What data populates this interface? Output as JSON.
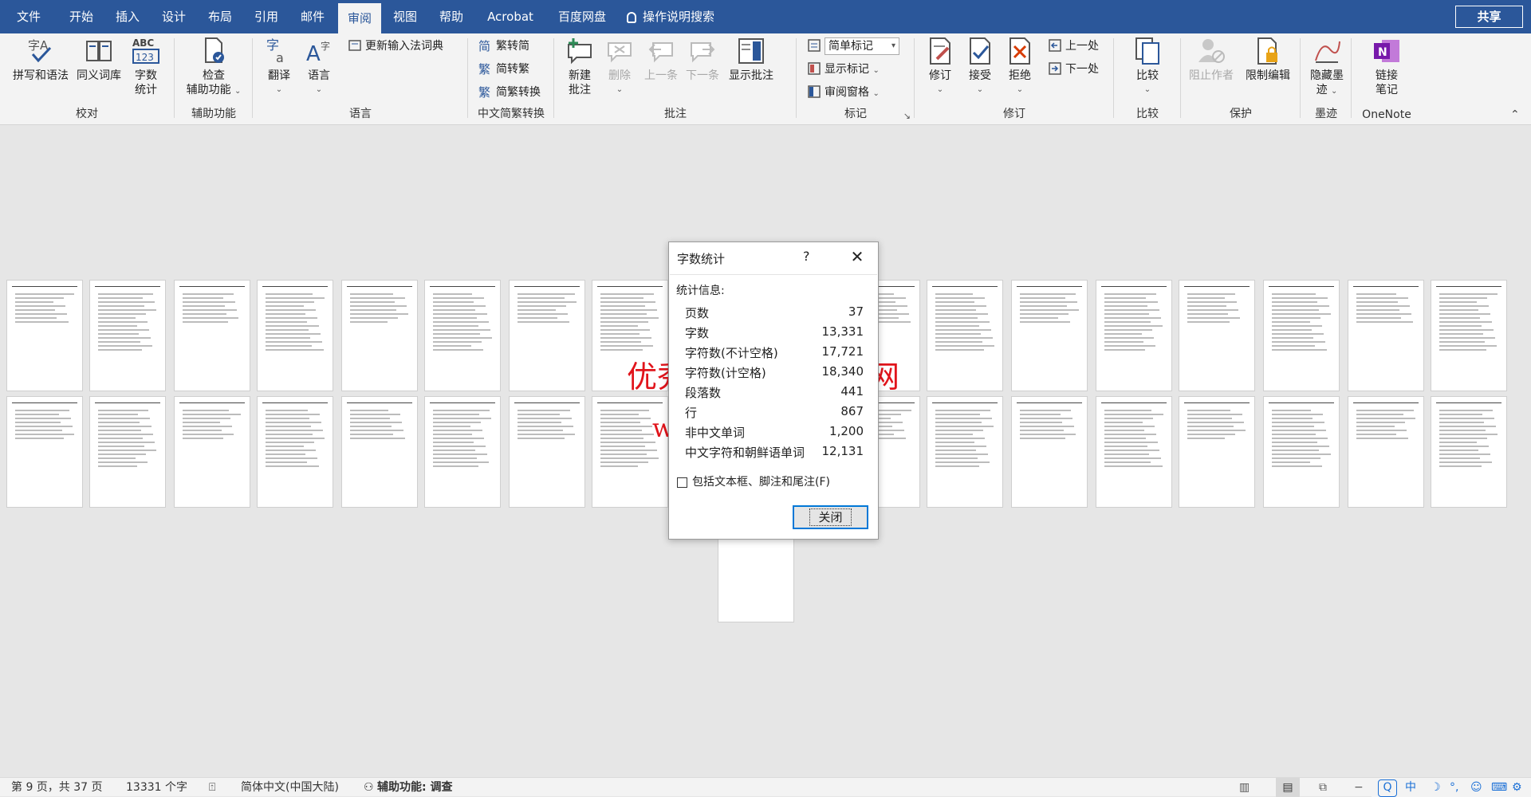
{
  "tabs": [
    "文件",
    "开始",
    "插入",
    "设计",
    "布局",
    "引用",
    "邮件",
    "审阅",
    "视图",
    "帮助",
    "Acrobat",
    "百度网盘"
  ],
  "active_tab": "审阅",
  "tell_me": "操作说明搜索",
  "share": "共享",
  "ribbon": {
    "proofing": {
      "spell": "拼写和语法",
      "thesaurus": "同义词库",
      "wordcount_line1": "字数",
      "wordcount_line2": "统计",
      "group": "校对",
      "abc": "ABC",
      "n123": "123"
    },
    "accessibility": {
      "check_line1": "检查",
      "check_line2": "辅助功能",
      "group": "辅助功能"
    },
    "language": {
      "translate": "翻译",
      "language": "语言",
      "update_ime": "更新输入法词典",
      "group": "语言"
    },
    "chinese": {
      "to_trad": "繁转简",
      "to_simp": "简转繁",
      "convert": "简繁转换",
      "group": "中文简繁转换"
    },
    "comments": {
      "new_line1": "新建",
      "new_line2": "批注",
      "delete": "删除",
      "prev": "上一条",
      "next": "下一条",
      "show": "显示批注",
      "group": "批注"
    },
    "tracking": {
      "markup_select": "简单标记",
      "show_markup": "显示标记",
      "review_pane": "审阅窗格",
      "group": "标记"
    },
    "changes": {
      "track": "修订",
      "accept": "接受",
      "reject": "拒绝",
      "prev": "上一处",
      "next": "下一处",
      "group": "修订"
    },
    "compare": {
      "compare": "比较",
      "group": "比较"
    },
    "protect": {
      "block": "阻止作者",
      "restrict": "限制编辑",
      "group": "保护"
    },
    "ink": {
      "hide_line1": "隐藏墨",
      "hide_line2": "迹",
      "group": "墨迹"
    },
    "onenote": {
      "link_line1": "链接",
      "link_line2": "笔记",
      "group": "OneNote"
    }
  },
  "dialog": {
    "title": "字数统计",
    "help": "?",
    "section": "统计信息:",
    "stats": [
      {
        "label": "页数",
        "value": "37"
      },
      {
        "label": "字数",
        "value": "13,331"
      },
      {
        "label": "字符数(不计空格)",
        "value": "17,721"
      },
      {
        "label": "字符数(计空格)",
        "value": "18,340"
      },
      {
        "label": "段落数",
        "value": "441"
      },
      {
        "label": "行",
        "value": "867"
      },
      {
        "label": "非中文单词",
        "value": "1,200"
      },
      {
        "label": "中文字符和朝鲜语单词",
        "value": "12,131"
      }
    ],
    "checkbox": "包括文本框、脚注和尾注(F)",
    "close_button": "关闭"
  },
  "watermark": {
    "line1": "优秀毕业设计资源网",
    "line2": "www.keyicad.cn"
  },
  "status": {
    "page": "第 9 页，共 37 页",
    "words": "13331 个字",
    "language": "简体中文(中国大陆)",
    "accessibility": "辅助功能: 调查"
  },
  "tray": {
    "lang": "中",
    "moon": "☽",
    "dots": "°,",
    "smile": "☺",
    "gear": "⚙"
  },
  "colors": {
    "accent": "#2b579a",
    "watermark": "#e1141b",
    "focus": "#0078d7"
  }
}
